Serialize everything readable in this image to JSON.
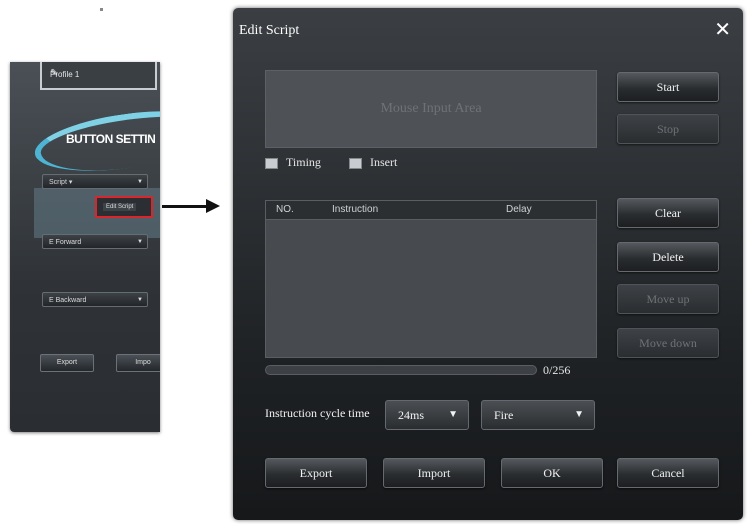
{
  "left_panel": {
    "profile_name": "Profile 1",
    "section_title": "BUTTON SETTIN",
    "selects": [
      "Script ▾",
      "E Forward",
      "E Backward"
    ],
    "edit_script_label": "Edit Script",
    "export_label": "Export",
    "import_label": "Impo"
  },
  "dialog": {
    "title": "Edit Script",
    "close_icon": "close-icon",
    "mouse_input_area": "Mouse Input Area",
    "start_label": "Start",
    "stop_label": "Stop",
    "timing_label": "Timing",
    "insert_label": "Insert",
    "columns": [
      "NO.",
      "Instruction",
      "Delay"
    ],
    "clear_label": "Clear",
    "delete_label": "Delete",
    "move_up_label": "Move up",
    "move_down_label": "Move down",
    "counter": "0/256",
    "cycle_label": "Instruction cycle time",
    "cycle_value": "24ms",
    "mode_value": "Fire",
    "export_label": "Export",
    "import_label": "Import",
    "ok_label": "OK",
    "cancel_label": "Cancel"
  }
}
